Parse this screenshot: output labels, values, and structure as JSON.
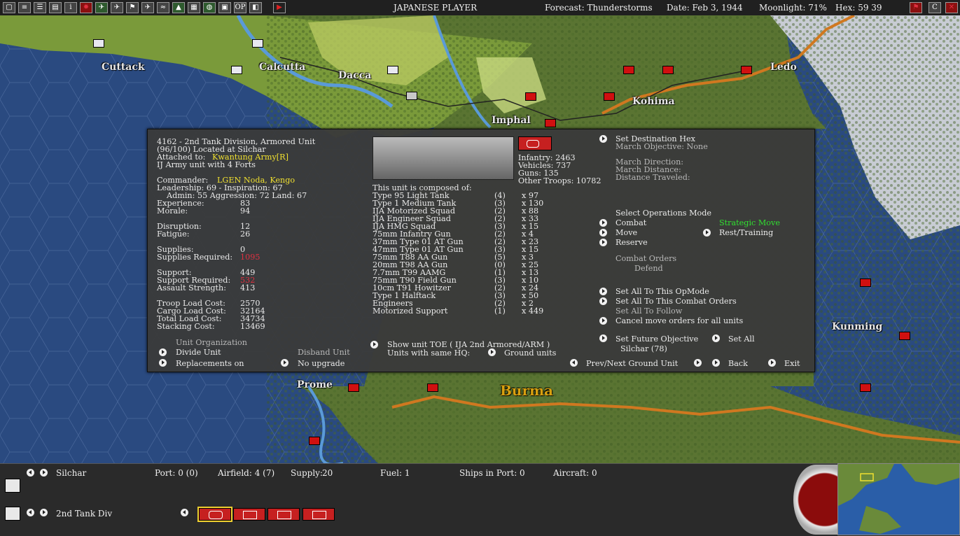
{
  "topbar": {
    "player": "JAPANESE PLAYER",
    "forecast": "Forecast: Thunderstorms",
    "date": "Date: Feb 3, 1944",
    "moonlight": "Moonlight: 71%",
    "hex": "Hex: 59 39"
  },
  "map": {
    "labels": {
      "cuttack": "Cuttack",
      "calcutta": "Calcutta",
      "dacca": "Dacca",
      "imphal": "Imphal",
      "kohima": "Kohima",
      "ledo": "Ledo",
      "kunming": "Kunming",
      "prome": "Prome",
      "burma": "Burma"
    }
  },
  "unit": {
    "title": "4162 - 2nd Tank Division, Armored Unit",
    "location": "(96/100) Located at Silchar",
    "attached_label": "Attached to:",
    "attached_value": "Kwantung Army[R]",
    "type_forts": "IJ Army unit with 4 Forts",
    "commander_label": "Commander:",
    "commander_value": "LGEN Noda, Kengo",
    "leadership": "Leadership: 69 - Inspiration: 67",
    "admin": "Admin: 55  Aggression: 72  Land: 67",
    "stats": [
      {
        "label": "Experience:",
        "value": "83"
      },
      {
        "label": "Morale:",
        "value": "94"
      },
      {
        "label": "Disruption:",
        "value": "12"
      },
      {
        "label": "Fatigue:",
        "value": "26"
      },
      {
        "label": "Supplies:",
        "value": "0"
      },
      {
        "label": "Supplies Required:",
        "value": "1095"
      },
      {
        "label": "Support:",
        "value": "449"
      },
      {
        "label": "Support Required:",
        "value": "532"
      },
      {
        "label": "Assault Strength:",
        "value": "413"
      },
      {
        "label": "Troop Load Cost:",
        "value": "2570"
      },
      {
        "label": "Cargo Load Cost:",
        "value": "32164"
      },
      {
        "label": "Total Load Cost:",
        "value": "34734"
      },
      {
        "label": "Stacking Cost:",
        "value": "13469"
      }
    ],
    "org_header": "Unit Organization",
    "divide_unit": "Divide Unit",
    "disband_unit": "Disband Unit",
    "replacements": "Replacements on",
    "upgrade": "No upgrade",
    "infantry": "Infantry: 2463",
    "vehicles": "Vehicles: 737",
    "guns": "Guns: 135",
    "other_troops": "Other Troops: 10782",
    "composed_header": "This unit is composed of:",
    "composition": [
      {
        "name": "Type 95 Light Tank",
        "need": "(4)",
        "count": "x 97"
      },
      {
        "name": "Type 1 Medium Tank",
        "need": "(3)",
        "count": "x 130"
      },
      {
        "name": "IJA Motorized Squad",
        "need": "(2)",
        "count": "x 88"
      },
      {
        "name": "IJA Engineer Squad",
        "need": "(2)",
        "count": "x 33"
      },
      {
        "name": "IJA HMG Squad",
        "need": "(3)",
        "count": "x 15"
      },
      {
        "name": "75mm Infantry Gun",
        "need": "(2)",
        "count": "x 4"
      },
      {
        "name": "37mm Type 01 AT Gun",
        "need": "(2)",
        "count": "x 23"
      },
      {
        "name": "47mm Type 01 AT Gun",
        "need": "(3)",
        "count": "x 15"
      },
      {
        "name": "75mm T88 AA Gun",
        "need": "(5)",
        "count": "x 3"
      },
      {
        "name": "20mm T98 AA Gun",
        "need": "(0)",
        "count": "x 25"
      },
      {
        "name": "7.7mm T99 AAMG",
        "need": "(1)",
        "count": "x 13"
      },
      {
        "name": "75mm T90 Field Gun",
        "need": "(3)",
        "count": "x 10"
      },
      {
        "name": "10cm T91 Howitzer",
        "need": "(2)",
        "count": "x 24"
      },
      {
        "name": "Type 1 Halftack",
        "need": "(3)",
        "count": "x 50"
      },
      {
        "name": "Engineers",
        "need": "(2)",
        "count": "x 2"
      },
      {
        "name": "Motorized Support",
        "need": "(1)",
        "count": "x 449"
      }
    ],
    "show_toe": "Show unit TOE ( IJA 2nd Armored/ARM )",
    "same_hq_label": "Units with same HQ:",
    "same_hq_value": "Ground units"
  },
  "orders": {
    "set_destination": "Set Destination Hex",
    "march_objective": "March Objective: None",
    "march_direction": "March Direction:",
    "march_distance": "March Distance:",
    "distance_traveled": "Distance Traveled:",
    "ops_header": "Select Operations Mode",
    "combat": "Combat",
    "strategic_move": "Strategic Move",
    "move": "Move",
    "rest_training": "Rest/Training",
    "reserve": "Reserve",
    "combat_orders": "Combat Orders",
    "defend": "Defend",
    "set_all_opmode": "Set All To This OpMode",
    "set_all_combat": "Set All To This Combat Orders",
    "set_all_follow": "Set All To Follow",
    "cancel_move": "Cancel move orders for all units",
    "set_future": "Set Future Objective",
    "set_all": "Set All",
    "future_value": "Silchar (78)",
    "prev_next": "Prev/Next Ground Unit",
    "back": "Back",
    "exit": "Exit"
  },
  "bottombar": {
    "location": "Silchar",
    "port": "Port: 0 (0)",
    "airfield": "Airfield: 4 (7)",
    "supply_label": "Supply:",
    "supply_value": "20",
    "fuel": "Fuel: 1",
    "ships": "Ships in Port: 0",
    "aircraft": "Aircraft: 0",
    "unit_name": "2nd Tank Div"
  },
  "colors": {
    "sea": "#2a4a80",
    "land": "#5a7a3a",
    "panel": "#3a3a3a",
    "highlight": "#f0e030",
    "warning": "#e03040",
    "active": "#30e030"
  }
}
